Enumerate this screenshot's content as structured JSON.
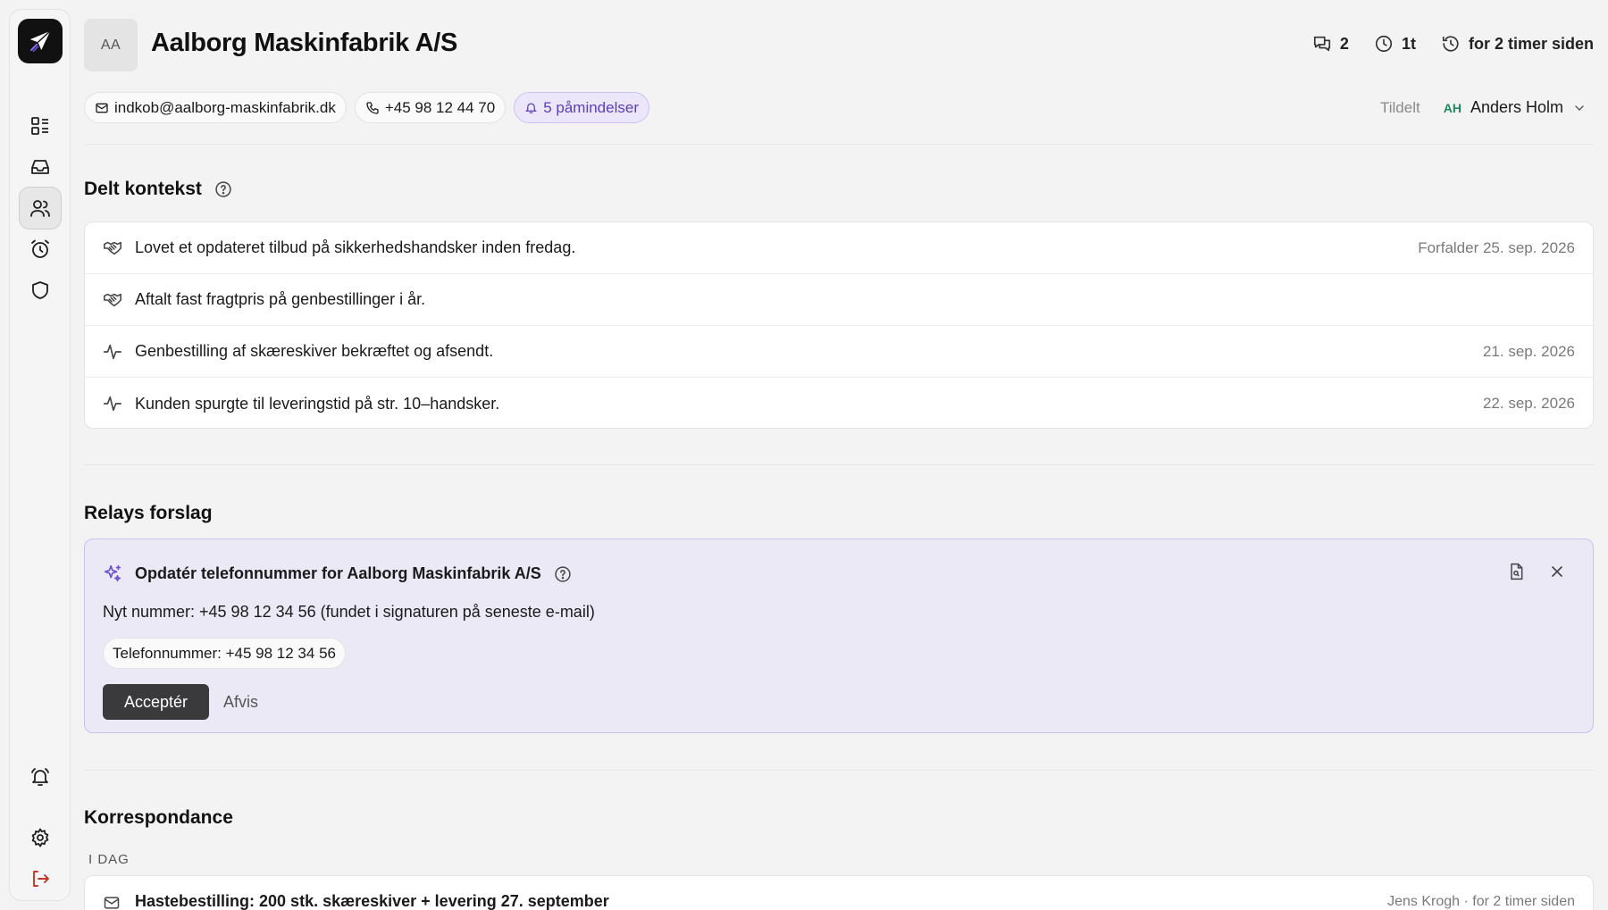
{
  "company": {
    "initials": "AA",
    "name": "Aalborg Maskinfabrik A/S"
  },
  "stats": {
    "messages": "2",
    "duration": "1t",
    "last_activity": "for 2 timer siden"
  },
  "contact": {
    "email": "indkob@aalborg-maskinfabrik.dk",
    "phone": "+45 98 12 44 70",
    "reminders": "5 påmindelser"
  },
  "assignment": {
    "label": "Tildelt",
    "initials": "AH",
    "name": "Anders Holm"
  },
  "shared_context": {
    "title": "Delt kontekst",
    "items": [
      {
        "icon": "handshake-icon",
        "text": "Lovet et opdateret tilbud på sikkerhedshandsker inden fredag.",
        "date": "Forfalder 25. sep. 2026"
      },
      {
        "icon": "handshake-icon",
        "text": "Aftalt fast fragtpris på genbestillinger i år.",
        "date": ""
      },
      {
        "icon": "activity-icon",
        "text": "Genbestilling af skæreskiver bekræftet og afsendt.",
        "date": "21. sep. 2026"
      },
      {
        "icon": "activity-icon",
        "text": "Kunden spurgte til leveringstid på str. 10–handsker.",
        "date": "22. sep. 2026"
      }
    ]
  },
  "suggestions": {
    "title": "Relays forslag",
    "card_title": "Opdatér telefonnummer for Aalborg Maskinfabrik A/S",
    "description": "Nyt nummer: +45 98 12 34 56 (fundet i signaturen på seneste e-mail)",
    "field": "Telefonnummer: +45 98 12 34 56",
    "accept_label": "Acceptér",
    "reject_label": "Afvis"
  },
  "correspondence": {
    "title": "Korrespondance",
    "group": "I DAG",
    "items": [
      {
        "subject": "Hastebestilling: 200 stk. skæreskiver + levering 27. september",
        "meta": "Jens Krogh · for 2 timer siden"
      }
    ]
  },
  "colors": {
    "accent_purple": "#6b4fd0",
    "reminder_bg": "#ece6fb",
    "logout_red": "#c0392b"
  }
}
